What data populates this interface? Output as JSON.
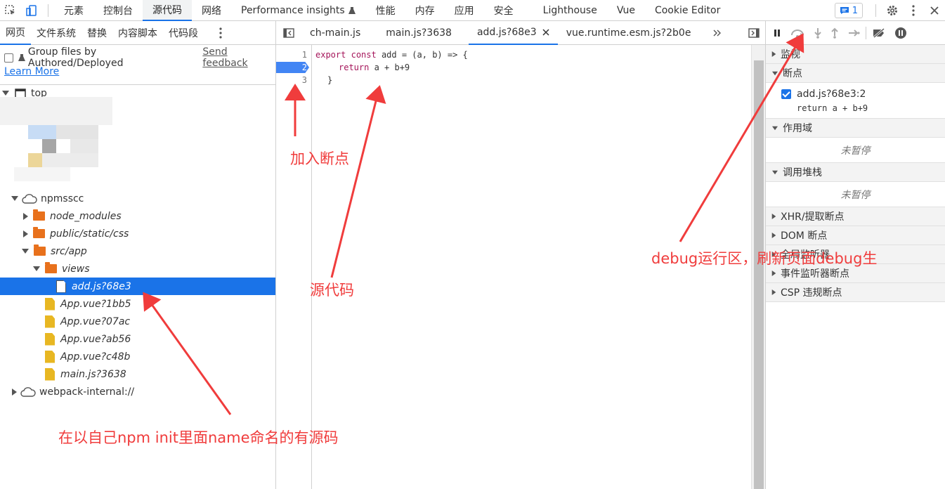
{
  "topbar": {
    "tabs": [
      "元素",
      "控制台",
      "源代码",
      "网络",
      "Performance insights",
      "性能",
      "内存",
      "应用",
      "安全",
      "Lighthouse",
      "Vue",
      "Cookie Editor"
    ],
    "active_tab": "源代码",
    "message_count": "1"
  },
  "navigator": {
    "tabs": [
      "网页",
      "文件系统",
      "替换",
      "内容脚本",
      "代码段"
    ],
    "group_label": "Group files by Authored/Deployed",
    "feedback": "Send feedback",
    "learn_more": "Learn More",
    "tree": {
      "top": "top",
      "npmsscc": "npmsscc",
      "node_modules": "node_modules",
      "public_css": "public/static/css",
      "src_app": "src/app",
      "views": "views",
      "add_js": "add.js?68e3",
      "files": [
        "App.vue?1bb5",
        "App.vue?07ac",
        "App.vue?ab56",
        "App.vue?c48b",
        "main.js?3638"
      ],
      "webpack": "webpack-internal://"
    }
  },
  "editor": {
    "tabs": [
      "ch-main.js",
      "main.js?3638",
      "add.js?68e3",
      "vue.runtime.esm.js?2b0e"
    ],
    "active_tab": "add.js?68e3",
    "line_numbers": [
      "1",
      "2",
      "3"
    ],
    "code": {
      "l1_kw1": "export",
      "l1_kw2": "const",
      "l1_rest": " add = (a, b) => {",
      "l2_kw": "return",
      "l2_rest": " a + b+9",
      "l3": "}"
    }
  },
  "debugger": {
    "sections": {
      "watch": "监视",
      "breakpoints": "断点",
      "scope": "作用域",
      "call_stack": "调用堆栈",
      "xhr": "XHR/提取断点",
      "dom": "DOM 断点",
      "global": "全局监听器",
      "event": "事件监听器断点",
      "csp": "CSP 违规断点"
    },
    "breakpoint_file": "add.js?68e3:2",
    "breakpoint_code": "return a + b+9",
    "not_paused": "未暂停"
  },
  "annotations": {
    "add_breakpoint": "加入断点",
    "source_code": "源代码",
    "debug_area": "debug运行区，刷新页面debug生",
    "npm_note": "在以自己npm init里面name命名的有源码"
  },
  "colors": {
    "accent": "#1a73e8",
    "annotation_red": "#f03c3c",
    "folder_orange": "#e8711c",
    "file_yellow": "#e8b722"
  }
}
